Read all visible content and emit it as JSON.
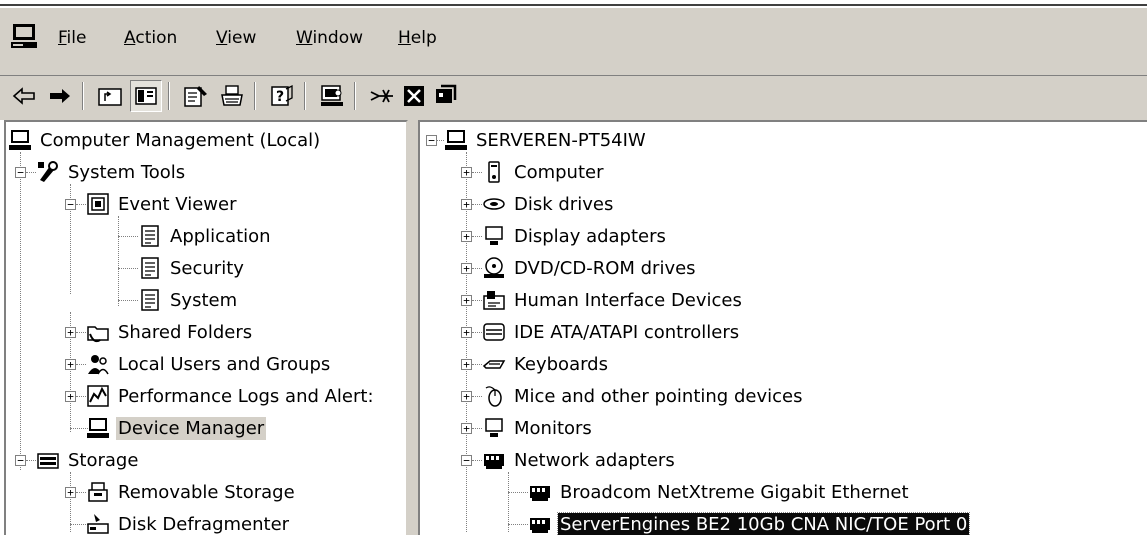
{
  "menubar": {
    "app_icon": "computer-management-icon",
    "items": [
      {
        "label": "File",
        "accel": "F",
        "rest": "ile"
      },
      {
        "label": "Action",
        "accel": "A",
        "rest": "ction"
      },
      {
        "label": "View",
        "accel": "V",
        "rest": "iew"
      },
      {
        "label": "Window",
        "accel": "W",
        "rest": "indow"
      },
      {
        "label": "Help",
        "accel": "H",
        "rest": "elp"
      }
    ]
  },
  "toolbar": {
    "buttons": [
      "back-icon",
      "forward-icon",
      "up-one-level-icon",
      "show-hide-tree-icon",
      "properties-icon",
      "print-icon",
      "help-icon",
      "scan-hardware-icon",
      "uninstall-icon",
      "disable-device-icon",
      "update-driver-icon"
    ]
  },
  "left_tree": {
    "root": "Computer Management (Local)",
    "system_tools": "System Tools",
    "event_viewer": "Event Viewer",
    "application": "Application",
    "security": "Security",
    "system": "System",
    "shared_folders": "Shared Folders",
    "local_users": "Local Users and Groups",
    "perf_logs": "Performance Logs and Alert:",
    "device_manager": "Device Manager",
    "storage": "Storage",
    "removable_storage": "Removable Storage",
    "disk_defrag": "Disk Defragmenter"
  },
  "right_tree": {
    "root": "SERVEREN-PT54IW",
    "computer": "Computer",
    "disk_drives": "Disk drives",
    "display_adapters": "Display adapters",
    "dvd": "DVD/CD-ROM drives",
    "hid": "Human Interface Devices",
    "ide": "IDE ATA/ATAPI controllers",
    "keyboards": "Keyboards",
    "mice": "Mice and other pointing devices",
    "monitors": "Monitors",
    "network_adapters": "Network adapters",
    "broadcom": "Broadcom NetXtreme Gigabit Ethernet",
    "serverengines": "ServerEngines BE2 10Gb CNA NIC/TOE Port 0"
  },
  "colors": {
    "chrome": "#d4d0c8",
    "selected_dark": "#0a0a0a",
    "selected_grey": "#d4d0c8"
  }
}
